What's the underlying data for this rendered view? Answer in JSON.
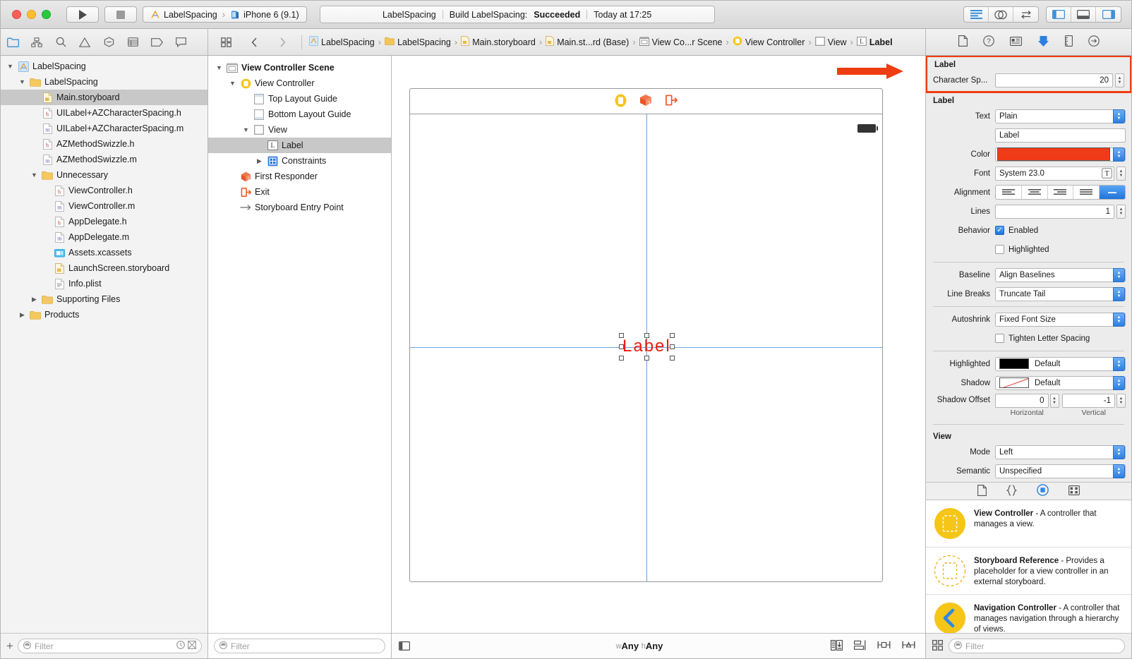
{
  "titlebar": {
    "run_label": "run-button",
    "stop_label": "stop-button",
    "scheme_project": "LabelSpacing",
    "scheme_sep": "›",
    "scheme_device": "iPhone 6 (9.1)",
    "status_project": "LabelSpacing",
    "status_action": "Build LabelSpacing:",
    "status_result": "Succeeded",
    "status_time": "Today at 17:25"
  },
  "bar2": {
    "crumbs": [
      {
        "label": "LabelSpacing",
        "icon": "xcode-project-icon"
      },
      {
        "label": "LabelSpacing",
        "icon": "folder-icon"
      },
      {
        "label": "Main.storyboard",
        "icon": "storyboard-file-icon"
      },
      {
        "label": "Main.st...rd (Base)",
        "icon": "storyboard-file-icon"
      },
      {
        "label": "View Co...r Scene",
        "icon": "scene-icon"
      },
      {
        "label": "View Controller",
        "icon": "view-controller-icon"
      },
      {
        "label": "View",
        "icon": "view-icon"
      },
      {
        "label": "Label",
        "icon": "label-icon"
      }
    ]
  },
  "navigator": {
    "items": [
      {
        "label": "LabelSpacing",
        "indent": 0,
        "tri": "open",
        "icon": "xcode-project-icon",
        "selected": false
      },
      {
        "label": "LabelSpacing",
        "indent": 1,
        "tri": "open",
        "icon": "folder-icon",
        "selected": false
      },
      {
        "label": "Main.storyboard",
        "indent": 2,
        "tri": "none",
        "icon": "storyboard-file-icon",
        "selected": true
      },
      {
        "label": "UILabel+AZCharacterSpacing.h",
        "indent": 2,
        "tri": "none",
        "icon": "header-file-icon",
        "selected": false
      },
      {
        "label": "UILabel+AZCharacterSpacing.m",
        "indent": 2,
        "tri": "none",
        "icon": "method-file-icon",
        "selected": false
      },
      {
        "label": "AZMethodSwizzle.h",
        "indent": 2,
        "tri": "none",
        "icon": "header-file-icon",
        "selected": false
      },
      {
        "label": "AZMethodSwizzle.m",
        "indent": 2,
        "tri": "none",
        "icon": "method-file-icon",
        "selected": false
      },
      {
        "label": "Unnecessary",
        "indent": 2,
        "tri": "open",
        "icon": "folder-icon",
        "selected": false
      },
      {
        "label": "ViewController.h",
        "indent": 3,
        "tri": "none",
        "icon": "header-file-icon",
        "selected": false
      },
      {
        "label": "ViewController.m",
        "indent": 3,
        "tri": "none",
        "icon": "method-file-icon",
        "selected": false
      },
      {
        "label": "AppDelegate.h",
        "indent": 3,
        "tri": "none",
        "icon": "header-file-icon",
        "selected": false
      },
      {
        "label": "AppDelegate.m",
        "indent": 3,
        "tri": "none",
        "icon": "method-file-icon",
        "selected": false
      },
      {
        "label": "Assets.xcassets",
        "indent": 3,
        "tri": "none",
        "icon": "assets-icon",
        "selected": false
      },
      {
        "label": "LaunchScreen.storyboard",
        "indent": 3,
        "tri": "none",
        "icon": "storyboard-file-icon",
        "selected": false
      },
      {
        "label": "Info.plist",
        "indent": 3,
        "tri": "none",
        "icon": "plist-icon",
        "selected": false
      },
      {
        "label": "Supporting Files",
        "indent": 2,
        "tri": "closed",
        "icon": "folder-icon",
        "selected": false
      },
      {
        "label": "Products",
        "indent": 1,
        "tri": "closed",
        "icon": "folder-icon",
        "selected": false
      }
    ],
    "filter_placeholder": "Filter"
  },
  "outline": {
    "items": [
      {
        "label": "View Controller Scene",
        "indent": 0,
        "tri": "open",
        "icon": "scene-icon",
        "bold": true,
        "selected": false
      },
      {
        "label": "View Controller",
        "indent": 1,
        "tri": "open",
        "icon": "view-controller-icon",
        "bold": false,
        "selected": false
      },
      {
        "label": "Top Layout Guide",
        "indent": 2,
        "tri": "none",
        "icon": "top-layout-guide-icon",
        "bold": false,
        "selected": false
      },
      {
        "label": "Bottom Layout Guide",
        "indent": 2,
        "tri": "none",
        "icon": "bottom-layout-guide-icon",
        "bold": false,
        "selected": false
      },
      {
        "label": "View",
        "indent": 2,
        "tri": "open",
        "icon": "view-icon",
        "bold": false,
        "selected": false
      },
      {
        "label": "Label",
        "indent": 3,
        "tri": "none",
        "icon": "label-icon",
        "bold": false,
        "selected": true
      },
      {
        "label": "Constraints",
        "indent": 3,
        "tri": "closed",
        "icon": "constraints-icon",
        "bold": false,
        "selected": false
      },
      {
        "label": "First Responder",
        "indent": 1,
        "tri": "none",
        "icon": "first-responder-icon",
        "bold": false,
        "selected": false
      },
      {
        "label": "Exit",
        "indent": 1,
        "tri": "none",
        "icon": "exit-icon",
        "bold": false,
        "selected": false
      },
      {
        "label": "Storyboard Entry Point",
        "indent": 1,
        "tri": "none",
        "icon": "entry-point-icon",
        "bold": false,
        "selected": false
      }
    ],
    "filter_placeholder": "Filter"
  },
  "canvas": {
    "label_text": "Label",
    "label_color": "#f01c0e",
    "size_class": {
      "w_prefix": "w",
      "w_value": "Any",
      "h_prefix": "h",
      "h_value": "Any"
    }
  },
  "inspector": {
    "runtime_section_title": "Label",
    "runtime_attr_label": "Character Sp...",
    "runtime_attr_value": "20",
    "label_section_title": "Label",
    "text_label": "Text",
    "text_value": "Plain",
    "text_content": "Label",
    "color_label": "Color",
    "color_value": "#ef3b17",
    "font_label": "Font",
    "font_value": "System 23.0",
    "alignment_label": "Alignment",
    "lines_label": "Lines",
    "lines_value": "1",
    "behavior_label": "Behavior",
    "enabled_label": "Enabled",
    "enabled_checked": true,
    "highlighted_cb_label": "Highlighted",
    "highlighted_cb_checked": false,
    "baseline_label": "Baseline",
    "baseline_value": "Align Baselines",
    "linebreaks_label": "Line Breaks",
    "linebreaks_value": "Truncate Tail",
    "autoshrink_label": "Autoshrink",
    "autoshrink_value": "Fixed Font Size",
    "tighten_label": "Tighten Letter Spacing",
    "tighten_checked": false,
    "highlighted_label": "Highlighted",
    "highlighted_value": "Default",
    "shadow_label": "Shadow",
    "shadow_value": "Default",
    "shadow_offset_label": "Shadow Offset",
    "shadow_h_value": "0",
    "shadow_v_value": "-1",
    "shadow_h_sub": "Horizontal",
    "shadow_v_sub": "Vertical",
    "view_section_title": "View",
    "mode_label": "Mode",
    "mode_value": "Left",
    "semantic_label": "Semantic",
    "semantic_value": "Unspecified",
    "library_items": [
      {
        "title": "View Controller",
        "desc": " - A controller that manages a view.",
        "icon": "view-controller-library-icon"
      },
      {
        "title": "Storyboard Reference",
        "desc": " - Provides a placeholder for a view controller in an external storyboard.",
        "icon": "storyboard-reference-icon"
      },
      {
        "title": "Navigation Controller",
        "desc": " - A controller that manages navigation through a hierarchy of views.",
        "icon": "navigation-controller-icon"
      }
    ],
    "library_filter_placeholder": "Filter"
  }
}
